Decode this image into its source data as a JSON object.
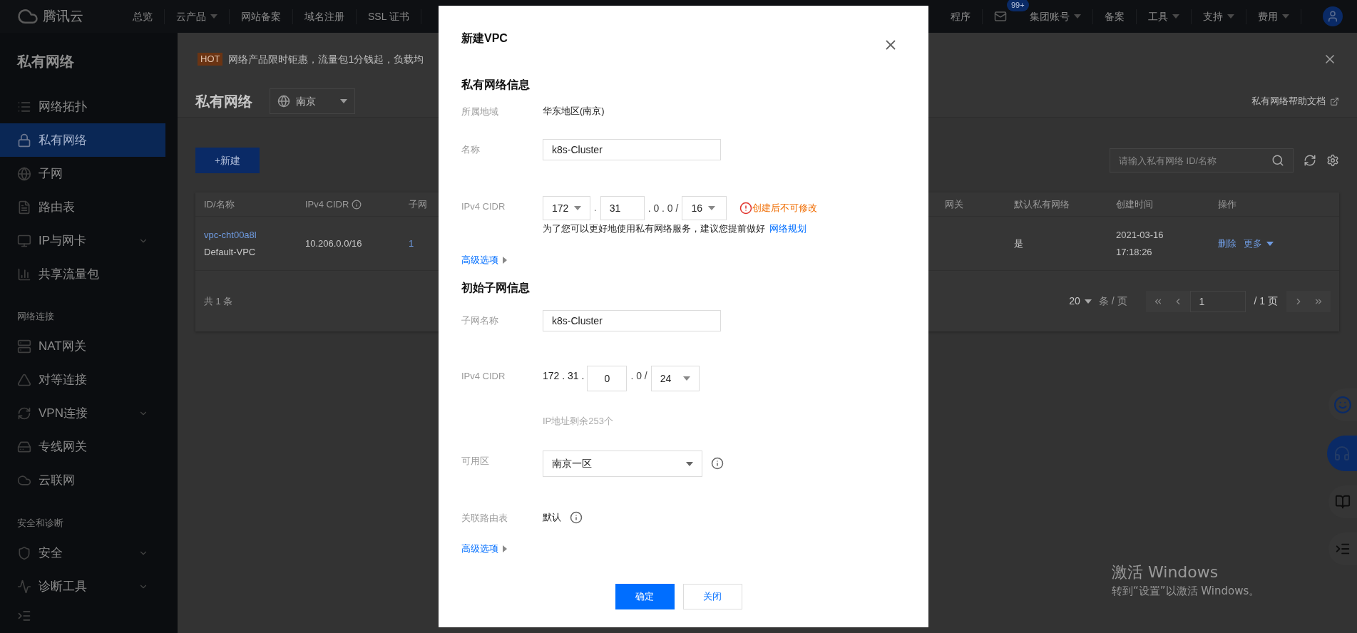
{
  "top_nav": {
    "logo": "腾讯云",
    "left_items": [
      {
        "label": "总览",
        "has_menu": false
      },
      {
        "label": "云产品",
        "has_menu": true
      },
      {
        "label": "网站备案",
        "has_menu": false
      },
      {
        "label": "域名注册",
        "has_menu": false
      },
      {
        "label": "SSL 证书",
        "has_menu": false
      }
    ],
    "right_items": [
      {
        "label": "程序",
        "has_menu": false
      },
      {
        "label": "集团账号",
        "has_menu": true
      },
      {
        "label": "备案",
        "has_menu": false
      },
      {
        "label": "工具",
        "has_menu": true
      },
      {
        "label": "支持",
        "has_menu": true
      },
      {
        "label": "费用",
        "has_menu": true
      }
    ],
    "mail_badge": "99+"
  },
  "sidebar": {
    "title": "私有网络",
    "groups": [
      {
        "items": [
          {
            "label": "网络拓扑",
            "selected": false,
            "expandable": false
          },
          {
            "label": "私有网络",
            "selected": true,
            "expandable": false
          },
          {
            "label": "子网",
            "selected": false,
            "expandable": false
          },
          {
            "label": "路由表",
            "selected": false,
            "expandable": false
          },
          {
            "label": "IP与网卡",
            "selected": false,
            "expandable": true
          },
          {
            "label": "共享流量包",
            "selected": false,
            "expandable": false
          }
        ]
      },
      {
        "heading": "网络连接",
        "items": [
          {
            "label": "NAT网关",
            "selected": false,
            "expandable": false
          },
          {
            "label": "对等连接",
            "selected": false,
            "expandable": false
          },
          {
            "label": "VPN连接",
            "selected": false,
            "expandable": true
          },
          {
            "label": "专线网关",
            "selected": false,
            "expandable": false
          },
          {
            "label": "云联网",
            "selected": false,
            "expandable": false
          }
        ]
      },
      {
        "heading": "安全和诊断",
        "items": [
          {
            "label": "安全",
            "selected": false,
            "expandable": true
          },
          {
            "label": "诊断工具",
            "selected": false,
            "expandable": true
          }
        ]
      }
    ]
  },
  "banner": {
    "tag": "HOT",
    "text": "网络产品限时钜惠，流量包1分钱起，负载均"
  },
  "page_header": {
    "title": "私有网络",
    "region": "南京",
    "help_link": "私有网络帮助文档"
  },
  "toolbar": {
    "new_button": "+新建",
    "search_placeholder": "请输入私有网络 ID/名称"
  },
  "table": {
    "columns": [
      {
        "label": "ID/名称",
        "info": false
      },
      {
        "label": "IPv4 CIDR",
        "info": true
      },
      {
        "label": "子网",
        "info": false
      },
      {
        "label": "网关",
        "info": false
      },
      {
        "label": "默认私有网络",
        "info": false
      },
      {
        "label": "创建时间",
        "info": false
      },
      {
        "label": "操作",
        "info": false
      }
    ],
    "rows": [
      {
        "id": "vpc-cht00a8l",
        "name": "Default-VPC",
        "cidr": "10.206.0.0/16",
        "subnets": "1",
        "is_default": "是",
        "created": [
          "2021-03-16",
          "17:18:26"
        ],
        "actions": [
          {
            "label": "删除",
            "has_menu": false
          },
          {
            "label": "更多",
            "has_menu": true
          }
        ]
      }
    ],
    "total": "共 1 条",
    "page_size": "20",
    "page_size_unit": "条 / 页",
    "page": "1",
    "page_total": "/ 1 页"
  },
  "modal": {
    "title": "新建VPC",
    "vpc_section": "私有网络信息",
    "region_label": "所属地域",
    "region_value": "华东地区(南京)",
    "name_label": "名称",
    "name_value": "k8s-Cluster",
    "cidr_label": "IPv4 CIDR",
    "cidr_first": "172",
    "cidr_dot1": ".",
    "cidr_second": "31",
    "cidr_middle": ". 0 . 0 /",
    "cidr_mask": "16",
    "cidr_warning": "创建后不可修改",
    "hint": "为了您可以更好地使用私有网络服务，建议您提前做好",
    "hint_link": "网络规划",
    "advanced": "高级选项",
    "subnet_section": "初始子网信息",
    "subnet_name_label": "子网名称",
    "subnet_name_value": "k8s-Cluster",
    "subnet_cidr_label": "IPv4 CIDR",
    "subnet_prefix": "172 . 31 .",
    "subnet_third": "0",
    "subnet_middle": ". 0 /",
    "subnet_mask": "24",
    "ip_remaining": "IP地址剩余253个",
    "zone_label": "可用区",
    "zone_value": "南京一区",
    "route_label": "关联路由表",
    "route_value": "默认",
    "advanced2": "高级选项",
    "confirm": "确定",
    "cancel": "关闭"
  },
  "windows_notice": {
    "title": "激活 Windows",
    "text": "转到“设置”以激活 Windows。"
  }
}
